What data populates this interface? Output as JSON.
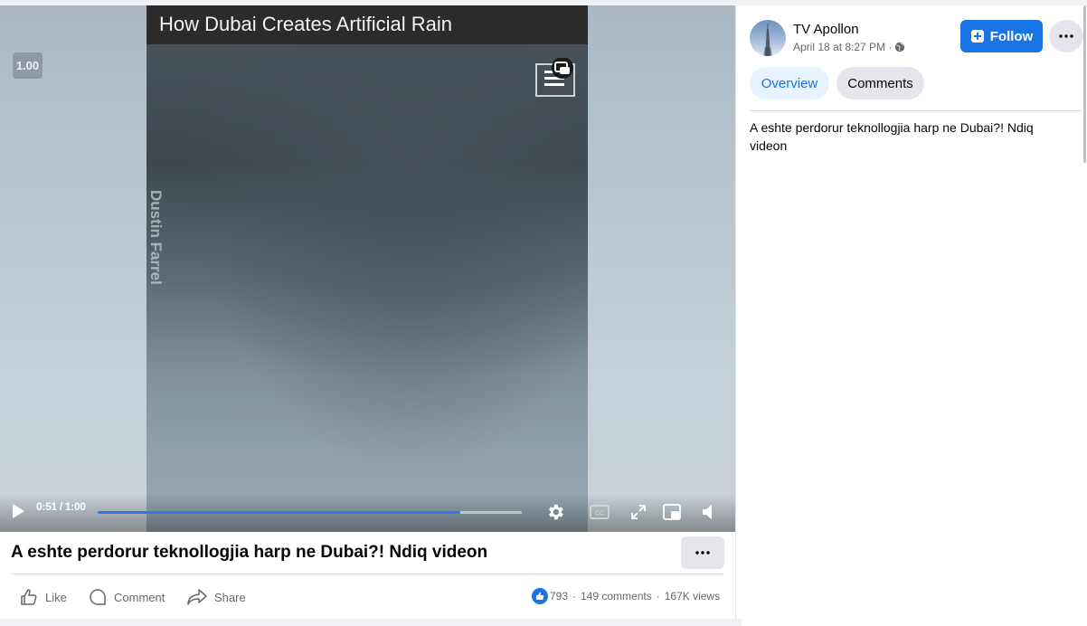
{
  "video": {
    "overlay_title": "How Dubai Creates Artificial Rain",
    "watermark": "Dustin Farrel",
    "speed": "1.00",
    "time": "0:51 / 1:00",
    "progress": 0.855
  },
  "post": {
    "title": "A eshte perdorur teknollogjia harp ne Dubai?! Ndiq videon",
    "actions": {
      "like": "Like",
      "comment": "Comment",
      "share": "Share"
    },
    "stats": {
      "reactions": "793",
      "comments": "149 comments",
      "views": "167K views",
      "separator": "·"
    }
  },
  "sidebar": {
    "page_name": "TV Apollon",
    "date": "April 18 at 8:27 PM ·",
    "follow_label": "Follow",
    "tabs": [
      {
        "label": "Overview"
      },
      {
        "label": "Comments"
      }
    ],
    "description": "A eshte perdorur teknollogjia harp ne Dubai?! Ndiq videon"
  },
  "colors": {
    "accent": "#1b74e4",
    "tab_active_bg": "#e7f3ff",
    "button_grey": "#e4e6eb"
  }
}
